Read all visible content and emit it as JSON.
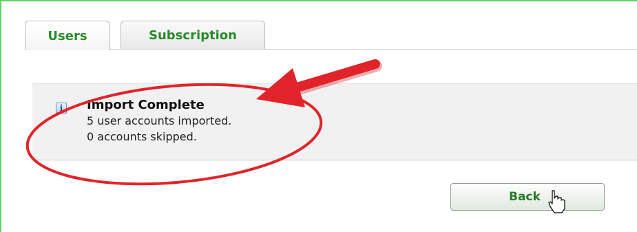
{
  "tabs": [
    {
      "label": "Users",
      "active": true
    },
    {
      "label": "Subscription",
      "active": false
    }
  ],
  "message": {
    "icon": "info-icon",
    "icon_glyph": "i",
    "title": "Import Complete",
    "lines": [
      "5 user accounts imported.",
      "0 accounts skipped."
    ]
  },
  "actions": {
    "back_label": "Back"
  },
  "colors": {
    "accent_green": "#2a8a2a",
    "frame_green": "#5fd35f",
    "annotation_red": "#e0242a"
  }
}
